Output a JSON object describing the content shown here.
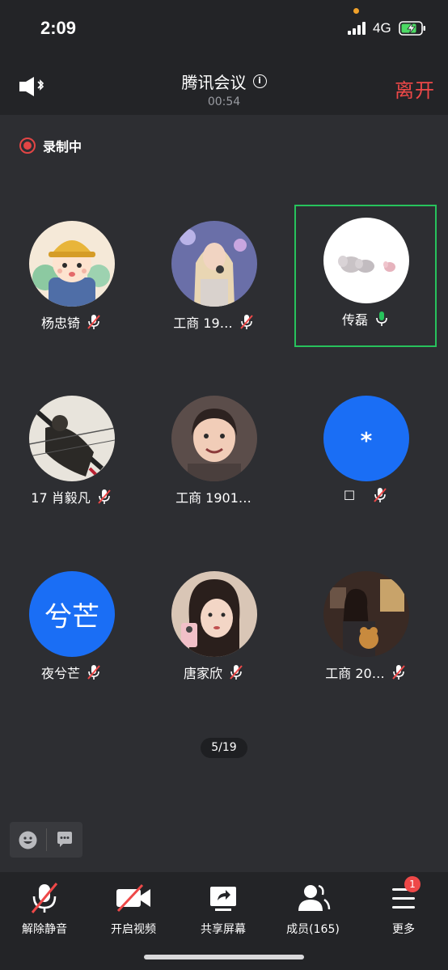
{
  "status_bar": {
    "time": "2:09",
    "network": "4G"
  },
  "header": {
    "title": "腾讯会议",
    "timer": "00:54",
    "leave_label": "离开"
  },
  "recording": {
    "label": "录制中"
  },
  "participants": [
    {
      "name": "杨忠锜",
      "mic": "muted"
    },
    {
      "name": "工商 19…",
      "mic": "muted"
    },
    {
      "name": "传磊",
      "mic": "on",
      "speaking": true
    },
    {
      "name": "17 肖毅凡",
      "mic": "muted"
    },
    {
      "name": "工商 1901…",
      "mic": "none"
    },
    {
      "name": "☐",
      "mic": "muted",
      "avatar_text": "*"
    },
    {
      "name": "夜兮芒",
      "mic": "muted",
      "avatar_text": "兮芒"
    },
    {
      "name": "唐家欣",
      "mic": "muted"
    },
    {
      "name": "工商 20…",
      "mic": "muted"
    }
  ],
  "pagination": {
    "label": "5/19"
  },
  "toolbar": {
    "unmute": "解除静音",
    "video": "开启视频",
    "share": "共享屏幕",
    "members": "成员(165)",
    "more": "更多",
    "more_badge": "1"
  },
  "colors": {
    "accent_blue": "#1a6ef5",
    "speaking_green": "#27c25c",
    "leave_red": "#ee4848"
  }
}
